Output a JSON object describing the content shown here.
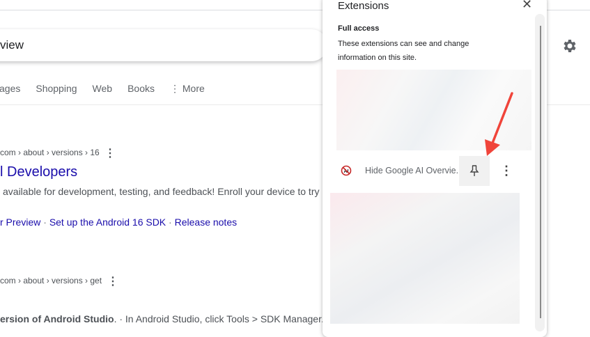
{
  "search": {
    "query": "view"
  },
  "tabs": [
    "ages",
    "Shopping",
    "Web",
    "Books",
    "⋮ More"
  ],
  "results": [
    {
      "breadcrumb": "com › about › versions › 16",
      "title": "l Developers",
      "snippet": "available for development, testing, and feedback! Enroll your device to try",
      "links": [
        "r Preview",
        "Set up the Android 16 SDK",
        "Release notes"
      ]
    },
    {
      "breadcrumb": "com › about › versions › get",
      "snippet_bold": "ersion of Android Studio",
      "snippet": ". · In Android Studio, click Tools > SDK Manager."
    }
  ],
  "panel": {
    "title": "Extensions",
    "section": "Full access",
    "description": "These extensions can see and change information on this site.",
    "extension": {
      "name": "Hide Google AI Overvie...",
      "icon": "ai-blocked-icon"
    }
  },
  "colors": {
    "link": "#1a0dab",
    "arrow": "#f0443a"
  }
}
